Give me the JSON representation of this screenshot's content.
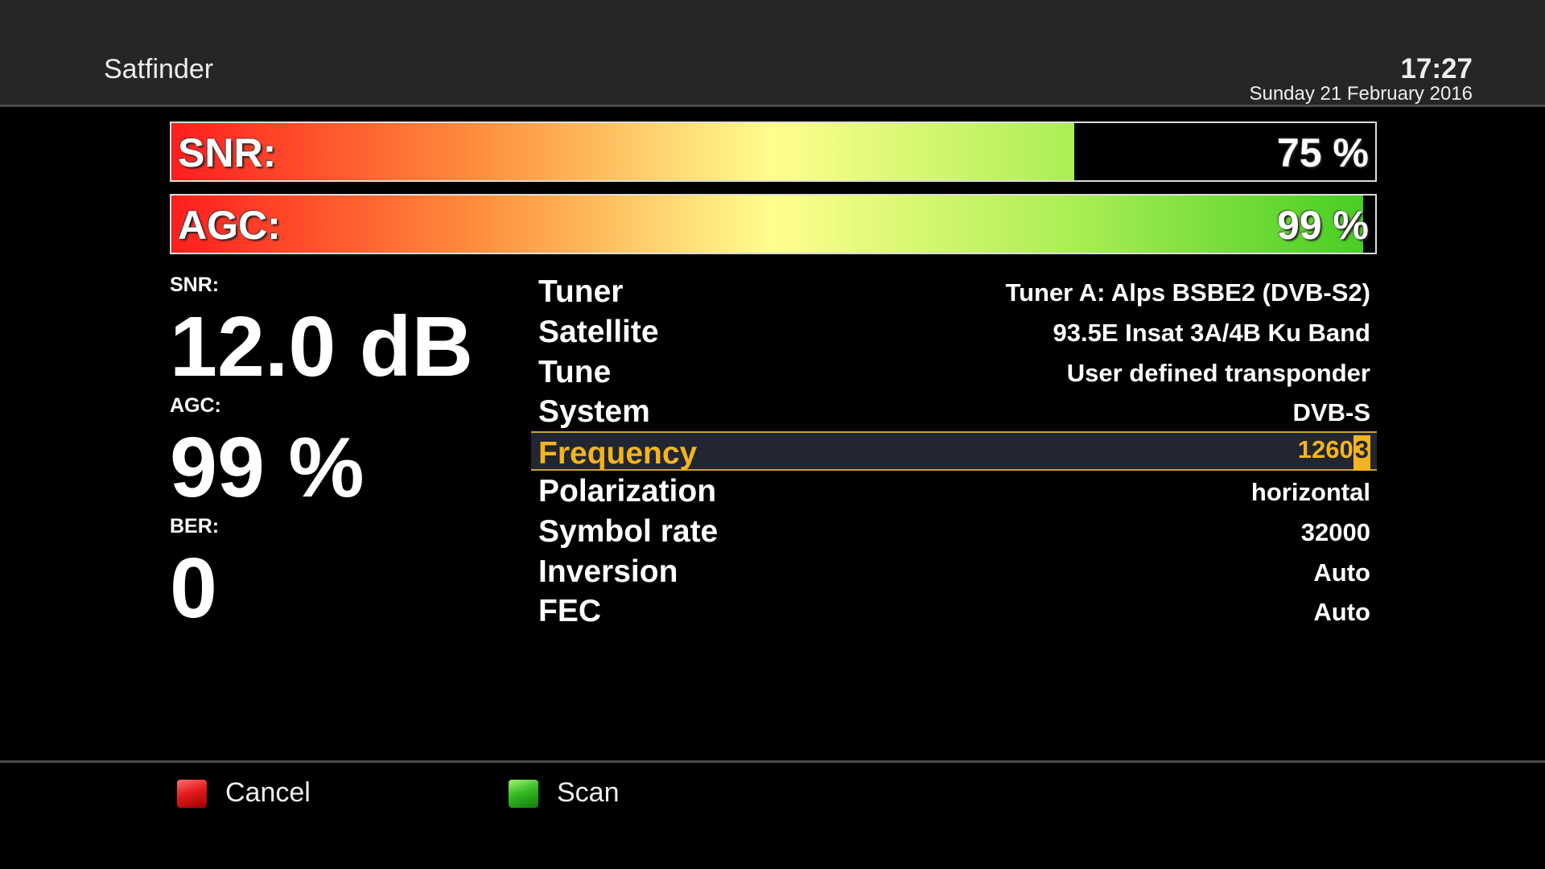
{
  "header": {
    "title": "Satfinder",
    "time": "17:27",
    "date": "Sunday 21 February 2016"
  },
  "bars": {
    "snr": {
      "label": "SNR:",
      "value_text": "75 %",
      "fill_percent": 75
    },
    "agc": {
      "label": "AGC:",
      "value_text": "99 %",
      "fill_percent": 99
    },
    "gradient_colors": [
      "#ff1e1e",
      "#ff8c3c",
      "#ffff8c",
      "#aaee55",
      "#44cc22"
    ]
  },
  "stats": {
    "snr": {
      "label": "SNR:",
      "value": "12.0 dB"
    },
    "agc": {
      "label": "AGC:",
      "value": "99 %"
    },
    "ber": {
      "label": "BER:",
      "value": "0"
    }
  },
  "info": {
    "rows": [
      {
        "label": "Tuner",
        "value": "Tuner A: Alps BSBE2 (DVB-S2)"
      },
      {
        "label": "Satellite",
        "value": "93.5E Insat 3A/4B Ku Band"
      },
      {
        "label": "Tune",
        "value": "User defined transponder"
      },
      {
        "label": "System",
        "value": "DVB-S"
      },
      {
        "label": "Frequency",
        "value_prefix": "1260",
        "value_cursor": "3",
        "selected": true
      },
      {
        "label": "Polarization",
        "value": "horizontal"
      },
      {
        "label": "Symbol rate",
        "value": "32000"
      },
      {
        "label": "Inversion",
        "value": "Auto"
      },
      {
        "label": "FEC",
        "value": "Auto"
      }
    ],
    "highlight_color": "#f3b51d"
  },
  "footer": {
    "cancel": {
      "label": "Cancel",
      "key_color": "red"
    },
    "scan": {
      "label": "Scan",
      "key_color": "green"
    }
  }
}
